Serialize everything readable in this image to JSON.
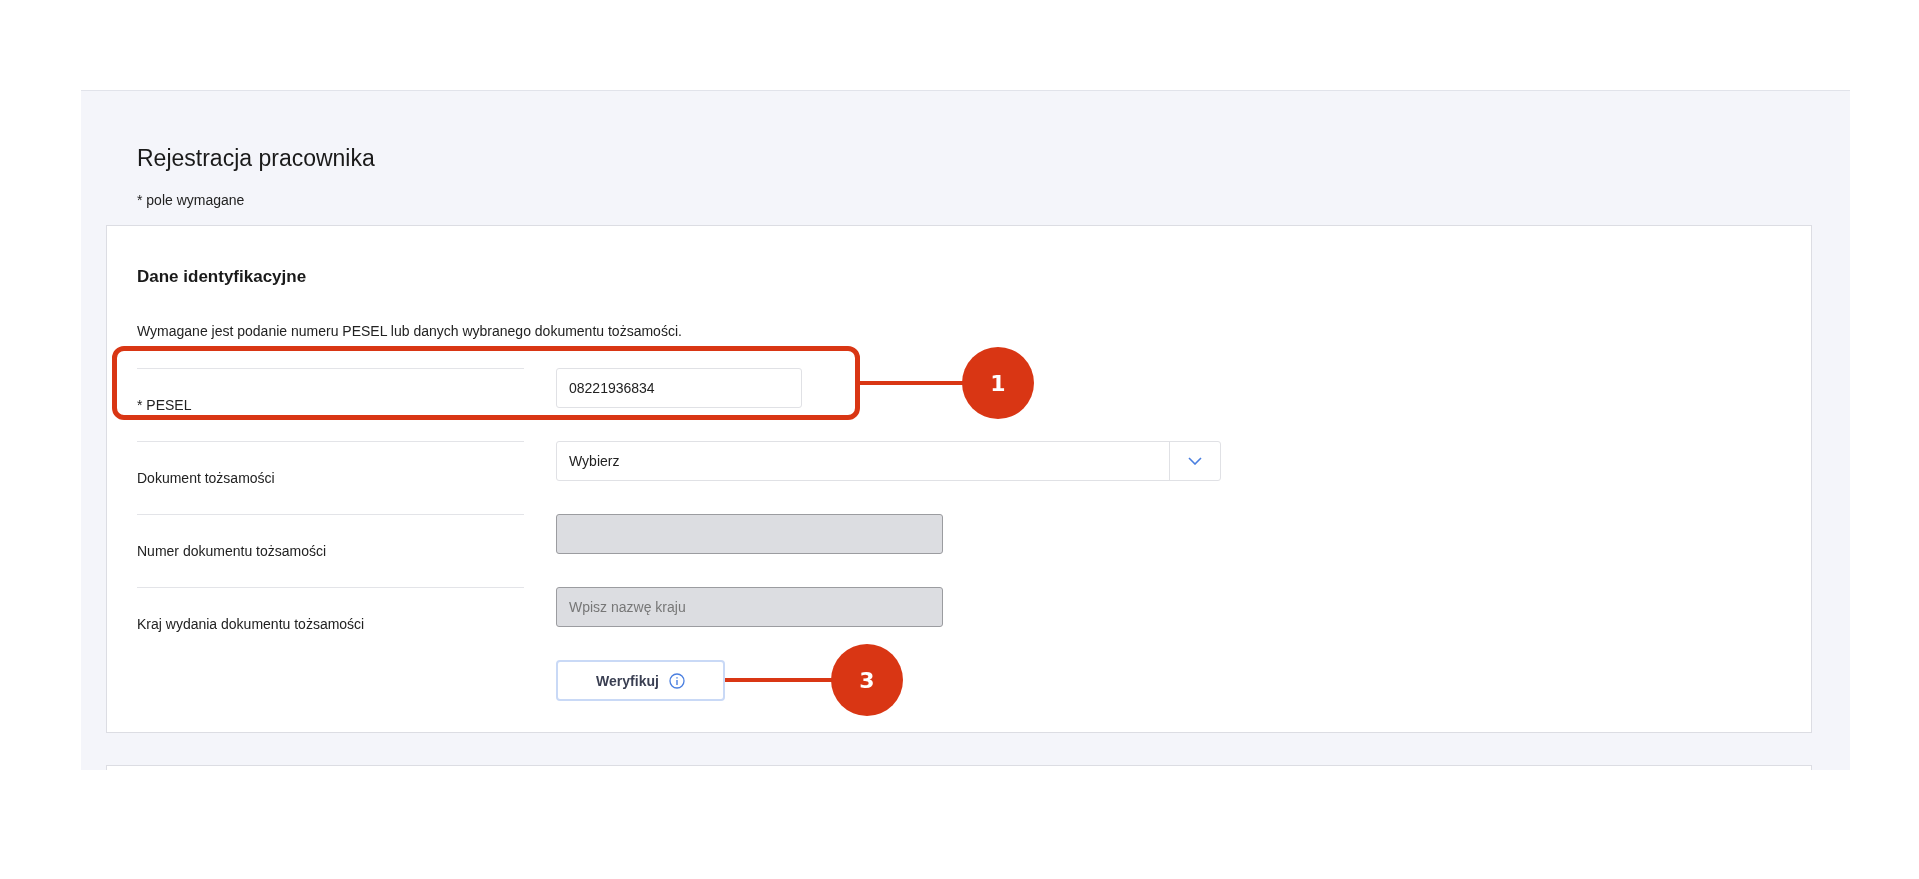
{
  "page": {
    "title": "Rejestracja pracownika",
    "required_note": "* pole wymagane"
  },
  "section": {
    "title": "Dane identyfikacyjne",
    "description": "Wymagane jest podanie numeru PESEL lub danych wybranego dokumentu tożsamości.",
    "fields": [
      {
        "kind": "input",
        "label": "* PESEL",
        "value": "08221936834",
        "disabled": false
      },
      {
        "kind": "select",
        "label": "Dokument tożsamości",
        "value": "Wybierz",
        "disabled": false
      },
      {
        "kind": "input",
        "label": "Numer dokumentu tożsamości",
        "disabled": true
      },
      {
        "kind": "input",
        "label": "Kraj wydania dokumentu tożsamości",
        "placeholder": "Wpisz nazwę kraju",
        "disabled": true
      }
    ],
    "button": {
      "label": "Weryfikuj"
    }
  },
  "annotations": [
    {
      "label": "1"
    },
    {
      "label": "3"
    }
  ]
}
